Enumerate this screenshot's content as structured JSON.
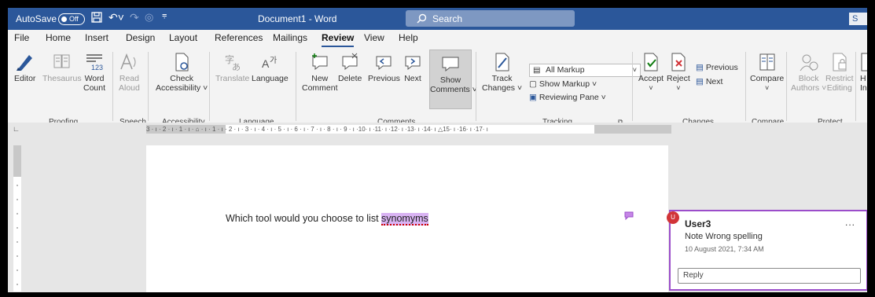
{
  "titlebar": {
    "autosave_label": "AutoSave",
    "autosave_state": "Off",
    "doc_title": "Document1 - Word",
    "search_placeholder": "Search",
    "share_partial": "S"
  },
  "tabs": [
    "File",
    "Home",
    "Insert",
    "Design",
    "Layout",
    "References",
    "Mailings",
    "Review",
    "View",
    "Help"
  ],
  "active_tab": "Review",
  "ribbon": {
    "proofing": {
      "editor": "Editor",
      "thesaurus": "Thesaurus",
      "word_count_1": "Word",
      "word_count_2": "Count",
      "group": "Proofing"
    },
    "speech": {
      "read_aloud_1": "Read",
      "read_aloud_2": "Aloud",
      "group": "Speech"
    },
    "accessibility": {
      "check_1": "Check",
      "check_2": "Accessibility ˅",
      "group": "Accessibility"
    },
    "language": {
      "translate": "Translate",
      "language": "Language",
      "group": "Language"
    },
    "comments": {
      "new_1": "New",
      "new_2": "Comment",
      "delete": "Delete",
      "previous": "Previous",
      "next": "Next",
      "show_1": "Show",
      "show_2": "Comments ˅",
      "group": "Comments"
    },
    "tracking": {
      "track_1": "Track",
      "track_2": "Changes ˅",
      "markup_select": "All Markup",
      "show_markup": "Show Markup ˅",
      "reviewing_pane": "Reviewing Pane ˅",
      "group": "Tracking"
    },
    "changes": {
      "accept": "Accept",
      "reject": "Reject",
      "previous": "Previous",
      "next": "Next",
      "group": "Changes"
    },
    "compare": {
      "compare": "Compare",
      "group": "Compare"
    },
    "protect": {
      "block_1": "Block",
      "block_2": "Authors ˅",
      "restrict_1": "Restrict",
      "restrict_2": "Editing",
      "group": "Protect"
    },
    "overflow": {
      "h": "H",
      "in": "In"
    }
  },
  "ruler_text": "3 · ı · 2 · ı · 1 · ı · ⌂ · ı · 1 · ı · 2 · ı · 3 · ı · 4 · ı · 5 · ı · 6 · ı · 7 · ı · 8 · ı · 9 · ı ·10· ı ·11· ı ·12· ı ·13· ı ·14· ı △15· ı ·16· ı ·17· ı",
  "document": {
    "text_before": "Which tool would you choose to list ",
    "highlighted_word": "synomyms"
  },
  "comment": {
    "initial": "U",
    "user": "User3",
    "more": "...",
    "text": "Note Wrong spelling",
    "date": "10 August 2021, 7:34 AM",
    "reply_placeholder": "Reply"
  },
  "colors": {
    "titlebar": "#2b579a",
    "comment_border": "#9b4dca",
    "highlight": "#d9b3f3",
    "avatar": "#d13438"
  }
}
